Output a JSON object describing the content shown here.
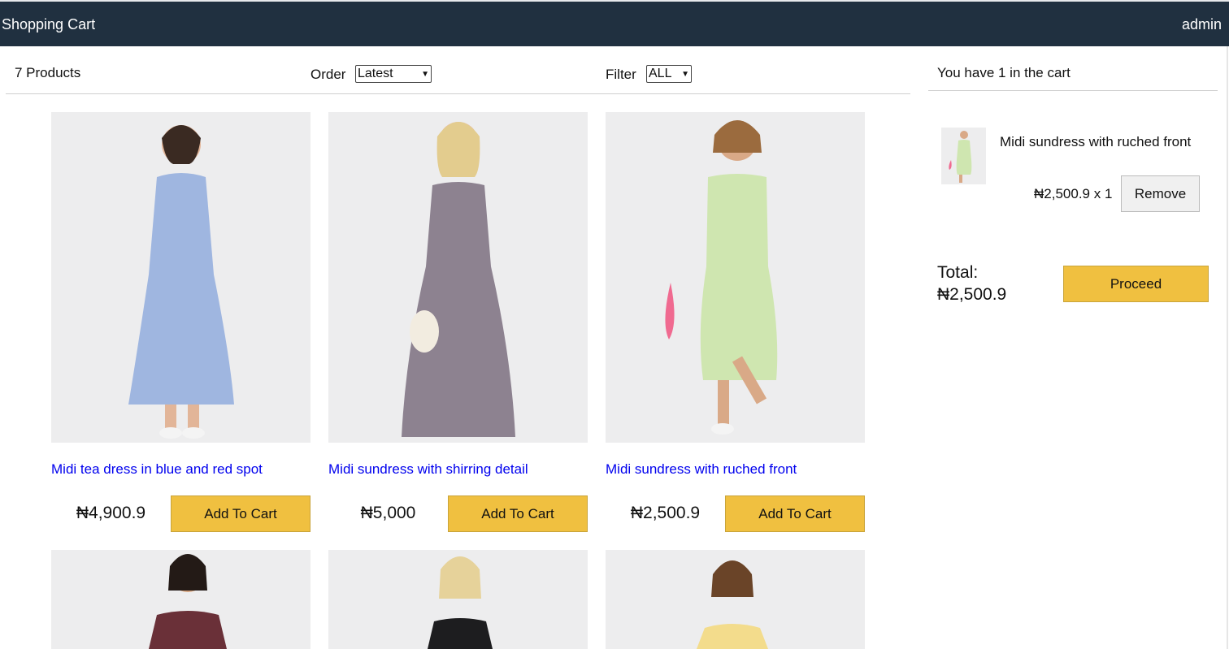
{
  "header": {
    "title": "Shopping Cart",
    "user": "admin"
  },
  "filters": {
    "count_label": "7 Products",
    "order_label": "Order",
    "order_value": "Latest",
    "filter_label": "Filter",
    "filter_value": "ALL"
  },
  "products": [
    {
      "title": "Midi tea dress in blue and red spot",
      "price": "₦4,900.9",
      "button": "Add To Cart",
      "dress_color": "#9fb6e0"
    },
    {
      "title": "Midi sundress with shirring detail",
      "price": "₦5,000",
      "button": "Add To Cart",
      "dress_color": "#8d8290"
    },
    {
      "title": "Midi sundress with ruched front",
      "price": "₦2,500.9",
      "button": "Add To Cart",
      "dress_color": "#cfe6b0"
    },
    {
      "title": "",
      "price": "",
      "button": "",
      "dress_color": "#6a3038"
    },
    {
      "title": "",
      "price": "",
      "button": "",
      "dress_color": "#1d1d1f"
    },
    {
      "title": "",
      "price": "",
      "button": "",
      "dress_color": "#f3dc8c"
    }
  ],
  "cart": {
    "summary": "You have 1 in the cart",
    "items": [
      {
        "title": "Midi sundress with ruched front",
        "qty_price": "₦2,500.9 x 1",
        "remove_label": "Remove"
      }
    ],
    "total_label": "Total:",
    "total_value": "₦2,500.9",
    "proceed_label": "Proceed"
  },
  "colors": {
    "header_bg": "#203040",
    "button_accent": "#f0c040",
    "link": "#0000ee"
  }
}
